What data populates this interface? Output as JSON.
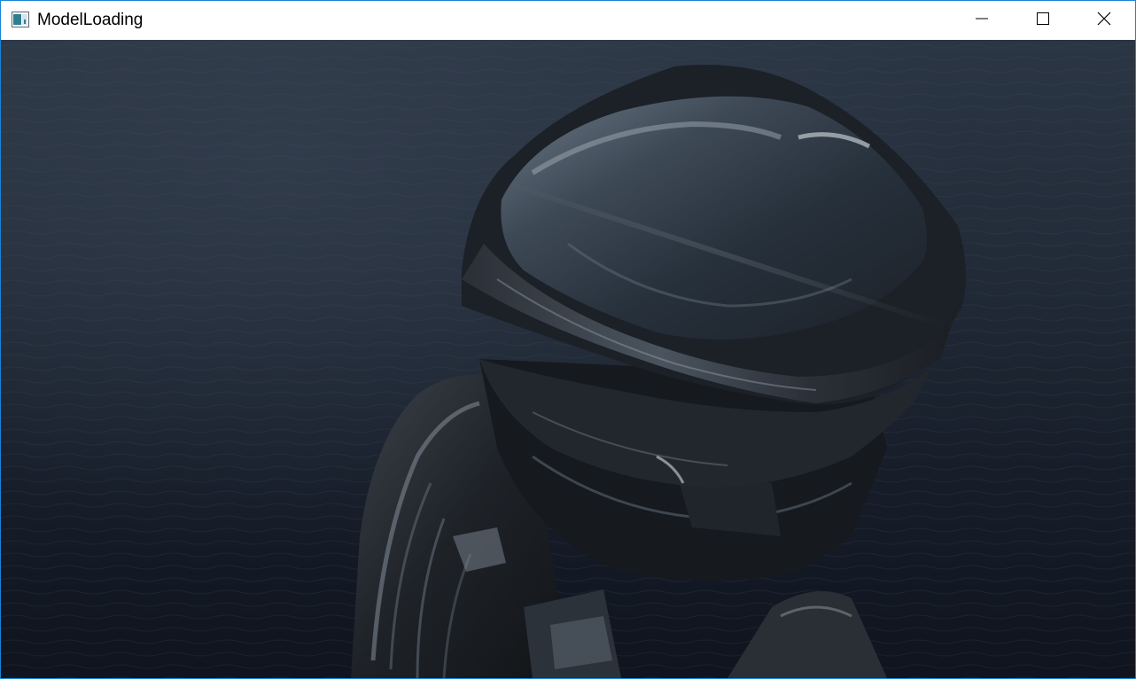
{
  "window": {
    "title": "ModelLoading",
    "accent_border": "#1883d7"
  },
  "titlebar": {
    "icons": {
      "app": "app-window-icon",
      "minimize": "minimize-icon",
      "maximize": "maximize-icon",
      "close": "close-icon"
    }
  },
  "viewport": {
    "scene": "ocean-skybox-with-helmeted-figure",
    "colors": {
      "water_dark": "#0f1621",
      "water_mid": "#27313f",
      "helmet_dark": "#15171b",
      "helmet_highlight": "#8d9aa6"
    }
  }
}
